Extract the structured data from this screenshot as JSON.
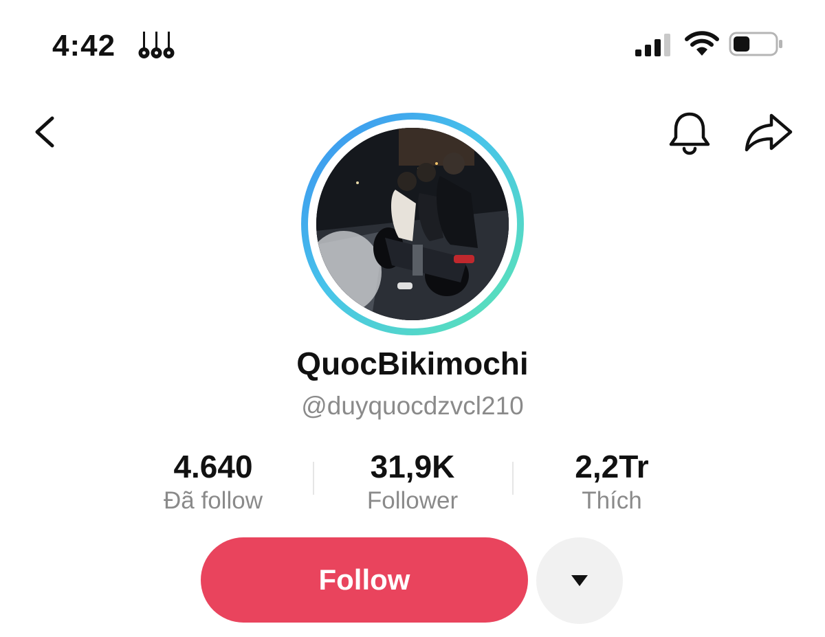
{
  "status_bar": {
    "time": "4:42",
    "glyph_icon": "music-instruments-icon",
    "signal_icon": "cellular-signal-icon",
    "wifi_icon": "wifi-icon",
    "battery_icon": "battery-icon",
    "battery_level": 0.4
  },
  "nav": {
    "back_icon": "chevron-left-icon",
    "bell_icon": "bell-icon",
    "share_icon": "share-arrow-icon"
  },
  "profile": {
    "display_name": "QuocBikimochi",
    "handle": "@duyquocdzvcl210",
    "avatar_ring_colors": [
      "#3a8ef0",
      "#47c3ea",
      "#5de6b0"
    ]
  },
  "stats": [
    {
      "value": "4.640",
      "label": "Đã follow"
    },
    {
      "value": "31,9K",
      "label": "Follower"
    },
    {
      "value": "2,2Tr",
      "label": "Thích"
    }
  ],
  "actions": {
    "follow_label": "Follow",
    "follow_color": "#e9445d",
    "more_icon": "caret-down-icon"
  }
}
